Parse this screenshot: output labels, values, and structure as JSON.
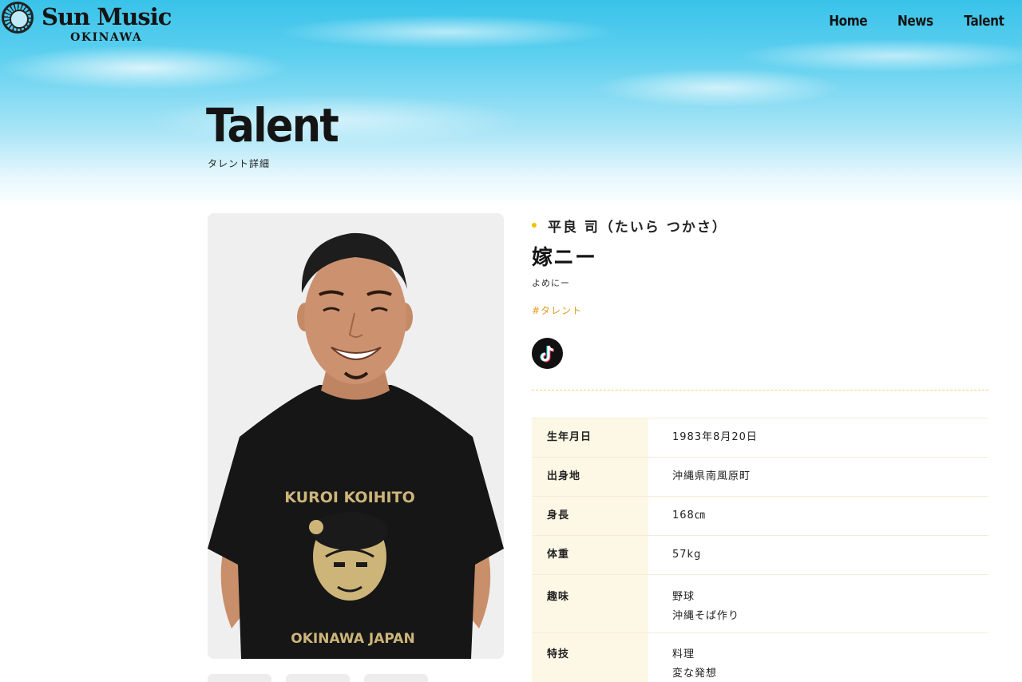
{
  "header": {
    "logo_main": "Sun Music",
    "logo_sub": "OKINAWA",
    "nav": [
      "Home",
      "News",
      "Talent"
    ]
  },
  "page": {
    "title": "Talent",
    "subtitle": "タレント詳細"
  },
  "photo": {
    "shirt_line1": "KUROI KOIHITO",
    "shirt_line2": "OKINAWA JAPAN"
  },
  "profile": {
    "real_name": "平良 司（たいら つかさ）",
    "stage_name": "嫁ニー",
    "stage_kana": "よめにー",
    "tag": "#タレント",
    "social": [
      "tiktok-icon"
    ],
    "specs": [
      {
        "label": "生年月日",
        "values": [
          "1983年8月20日"
        ]
      },
      {
        "label": "出身地",
        "values": [
          "沖縄県南風原町"
        ]
      },
      {
        "label": "身長",
        "values": [
          "168㎝"
        ]
      },
      {
        "label": "体重",
        "values": [
          "57kg"
        ]
      },
      {
        "label": "趣味",
        "values": [
          "野球",
          "沖縄そば作り"
        ]
      },
      {
        "label": "特技",
        "values": [
          "料理",
          "変な発想"
        ]
      }
    ]
  },
  "colors": {
    "accent_dot": "#f2c200",
    "tag": "#e69b1e",
    "spec_label_bg": "#fdf8e6",
    "sky": "#39c3ea"
  }
}
